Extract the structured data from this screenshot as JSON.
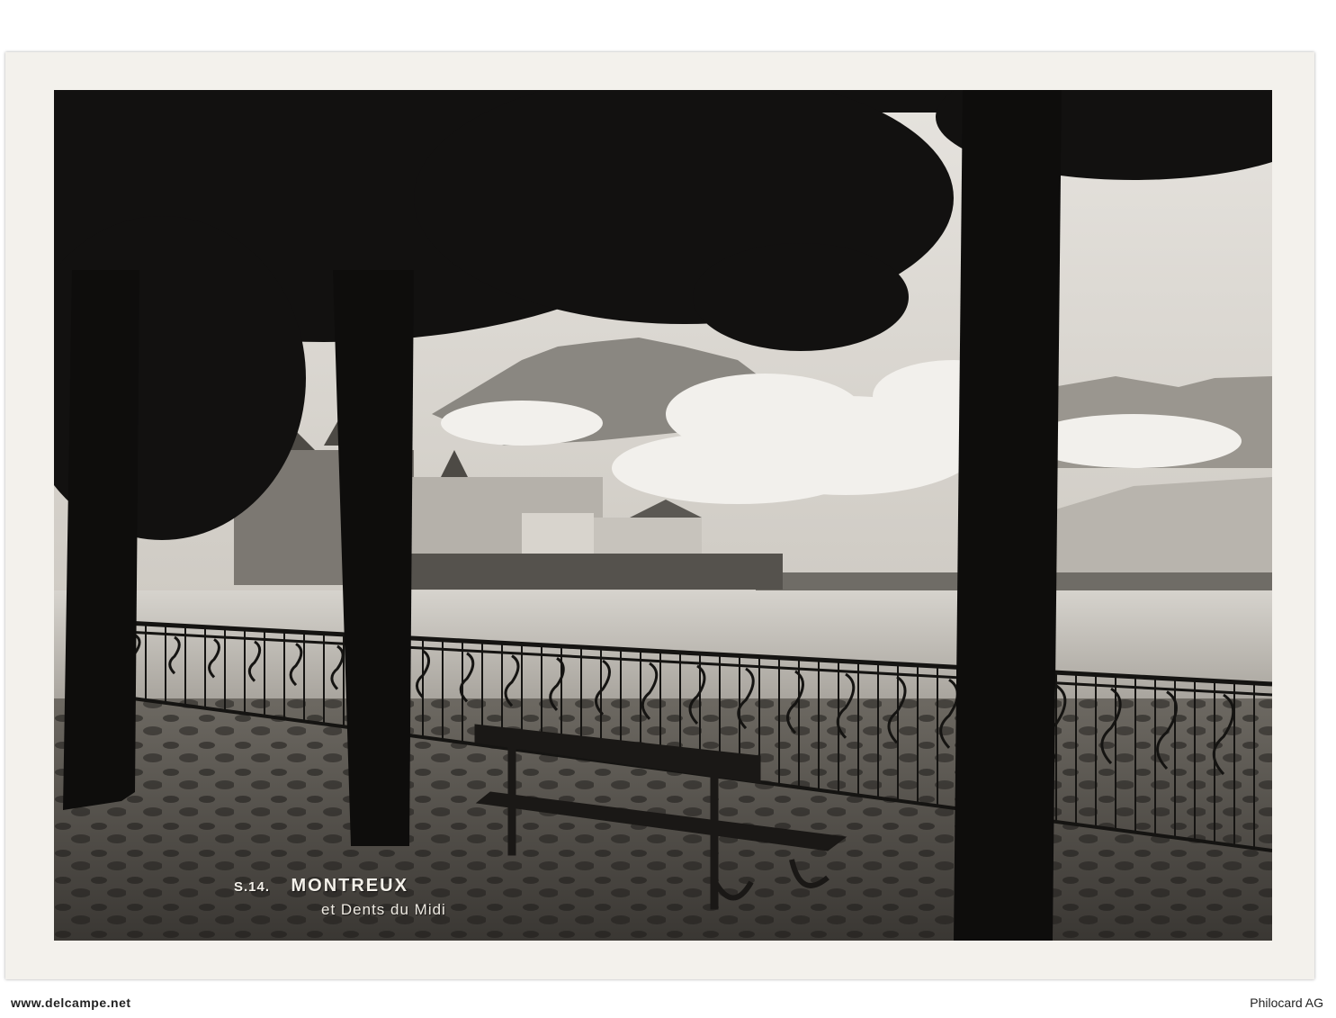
{
  "postcard": {
    "number": "S.14.",
    "title": "MONTREUX",
    "subtitle": "et Dents du Midi"
  },
  "watermark": {
    "left": "www.delcampe.net",
    "right": "Philocard AG"
  },
  "scene": {
    "tone": "sepia black-and-white photograph",
    "colors": {
      "sky": "#d9d6d0",
      "water": "#c9c6c0",
      "shadow": "#141414",
      "paper": "#f3f1ec"
    }
  }
}
